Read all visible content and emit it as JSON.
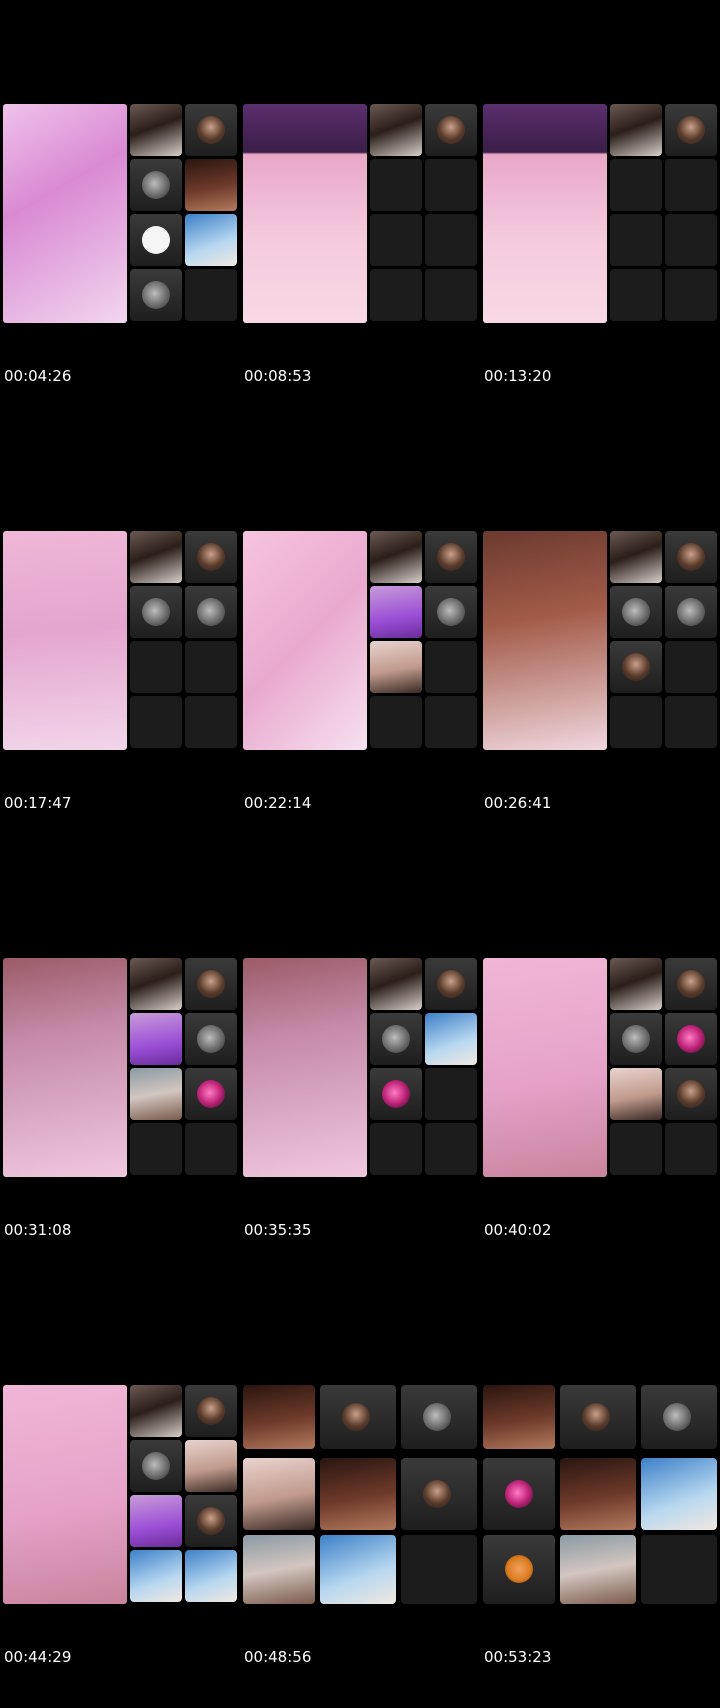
{
  "thumbnails": [
    {
      "timestamp": "00:04:26"
    },
    {
      "timestamp": "00:08:53"
    },
    {
      "timestamp": "00:13:20"
    },
    {
      "timestamp": "00:17:47"
    },
    {
      "timestamp": "00:22:14"
    },
    {
      "timestamp": "00:26:41"
    },
    {
      "timestamp": "00:31:08"
    },
    {
      "timestamp": "00:35:35"
    },
    {
      "timestamp": "00:40:02"
    },
    {
      "timestamp": "00:44:29"
    },
    {
      "timestamp": "00:48:56"
    },
    {
      "timestamp": "00:53:23"
    }
  ]
}
